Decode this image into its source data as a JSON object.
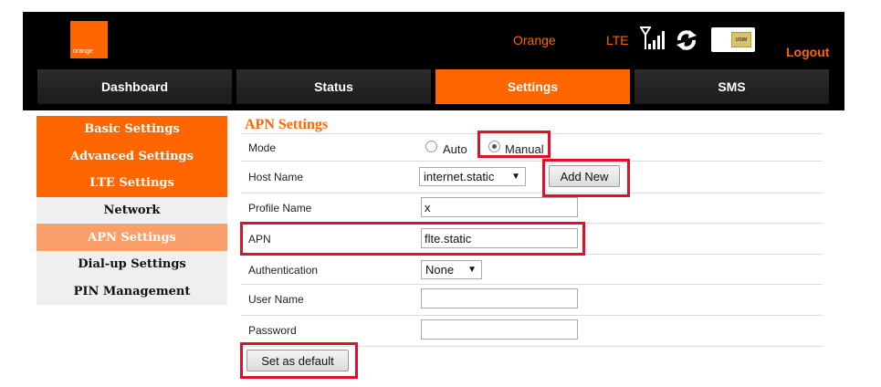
{
  "header": {
    "logo_text": "orange",
    "operator": "Orange",
    "network_type": "LTE",
    "sim_label": "USIM",
    "logout_label": "Logout"
  },
  "nav": {
    "tabs": [
      {
        "label": "Dashboard",
        "active": false
      },
      {
        "label": "Status",
        "active": false
      },
      {
        "label": "Settings",
        "active": true
      },
      {
        "label": "SMS",
        "active": false
      }
    ]
  },
  "sidebar": {
    "items": [
      {
        "label": "Basic Settings"
      },
      {
        "label": "Advanced Settings"
      },
      {
        "label": "LTE Settings"
      },
      {
        "label": "Network"
      },
      {
        "label": "APN Settings"
      },
      {
        "label": "Dial-up Settings"
      },
      {
        "label": "PIN Management"
      }
    ]
  },
  "form": {
    "title": "APN Settings",
    "mode": {
      "label": "Mode",
      "options": [
        "Auto",
        "Manual"
      ],
      "selected": "Manual"
    },
    "host_name": {
      "label": "Host Name",
      "value": "internet.static"
    },
    "add_new_label": "Add New",
    "profile_name": {
      "label": "Profile Name",
      "value": "x"
    },
    "apn": {
      "label": "APN",
      "value": "flte.static"
    },
    "authentication": {
      "label": "Authentication",
      "value": "None"
    },
    "user_name": {
      "label": "User Name",
      "value": ""
    },
    "password": {
      "label": "Password",
      "value": ""
    },
    "set_default_label": "Set as default"
  },
  "colors": {
    "brand": "#ff6600",
    "highlight": "#e0102a"
  },
  "icons": [
    "signal-icon",
    "sync-icon",
    "sim-card-icon"
  ]
}
